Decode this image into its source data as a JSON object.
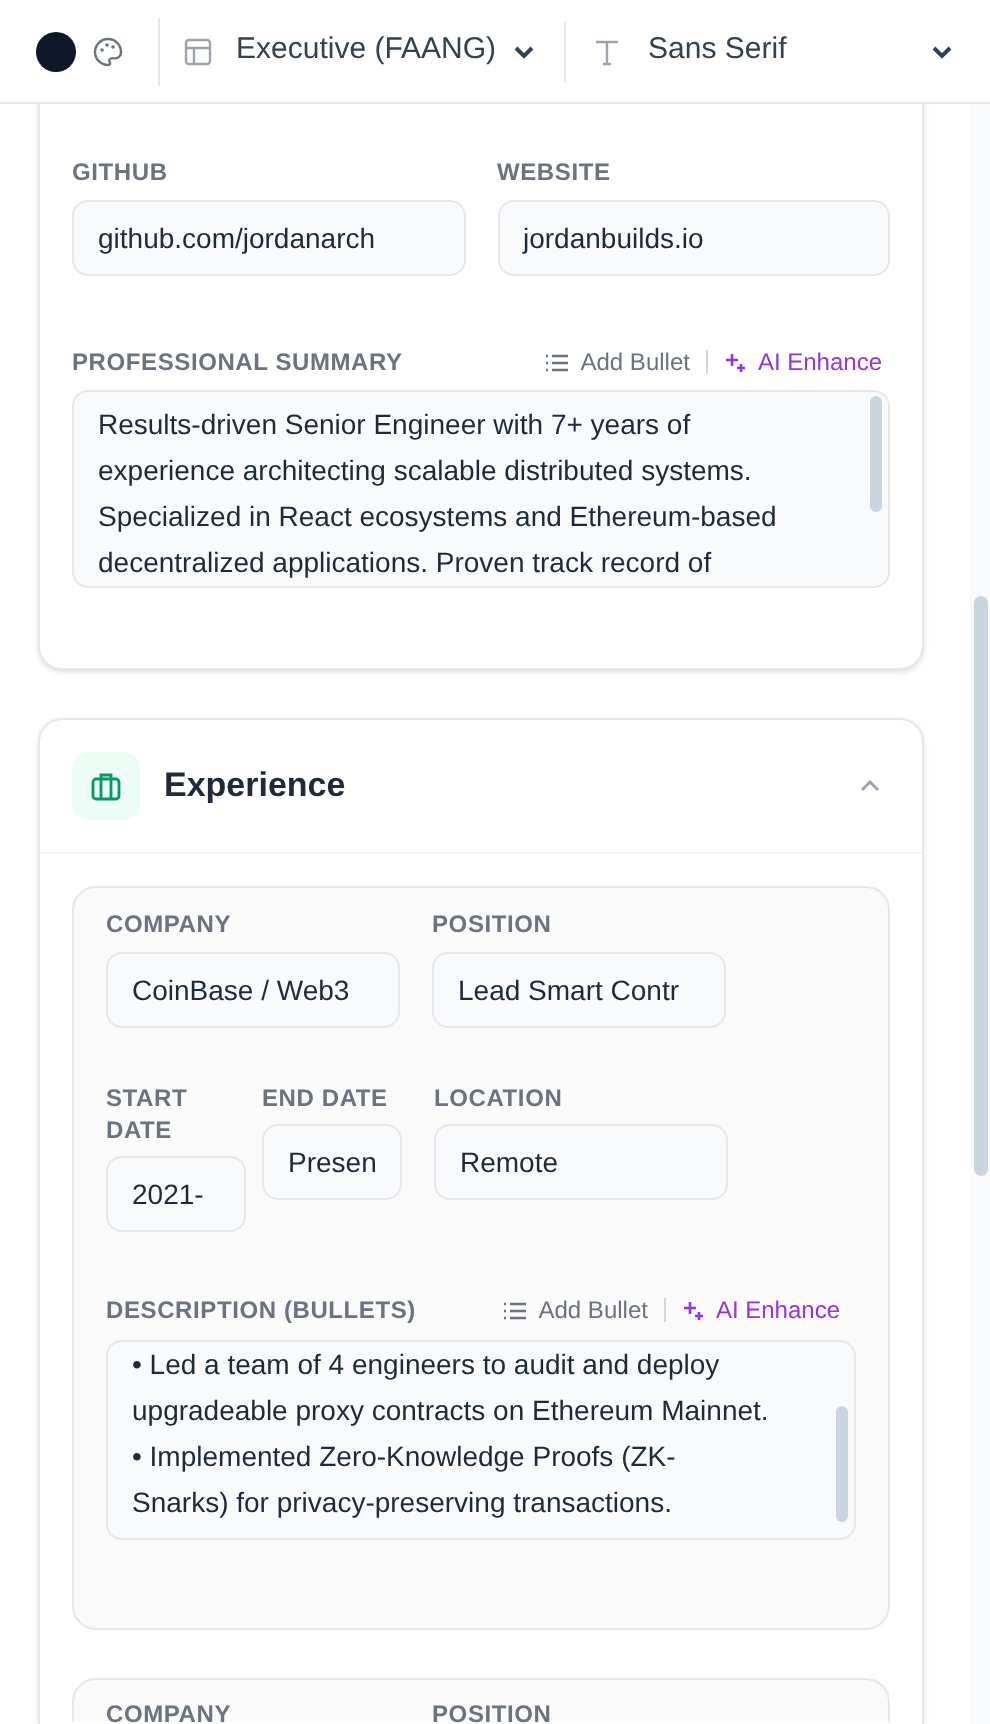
{
  "toolbar": {
    "template": "Executive (FAANG)",
    "font": "Sans Serif"
  },
  "links_section": {
    "fields": [
      {
        "label": "GITHUB",
        "value": "github.com/jordanarch"
      },
      {
        "label": "WEBSITE",
        "value": "jordanbuilds.io"
      }
    ],
    "summary": {
      "label": "PROFESSIONAL SUMMARY",
      "add_bullet": "Add Bullet",
      "ai_enhance": "AI Enhance",
      "lines": [
        "Results-driven Senior Engineer with 7+ years of",
        "experience architecting scalable distributed systems.",
        "Specialized in React ecosystems and Ethereum-based",
        "decentralized applications. Proven track record of"
      ]
    }
  },
  "experience": {
    "title": "Experience",
    "expanded": true,
    "entries": [
      {
        "company_label": "COMPANY",
        "company": "CoinBase / Web3",
        "position_label": "POSITION",
        "position": "Lead Smart Contr",
        "start_label": "START DATE",
        "start": "2021-",
        "end_label": "END DATE",
        "end": "Presen",
        "location_label": "LOCATION",
        "location": "Remote",
        "description_label": "DESCRIPTION (BULLETS)",
        "add_bullet": "Add Bullet",
        "ai_enhance": "AI Enhance",
        "lines": [
          "• Led a team of 4 engineers to audit and deploy",
          "upgradeable proxy contracts on Ethereum Mainnet.",
          "• Implemented Zero-Knowledge Proofs (ZK-",
          "Snarks) for privacy-preserving transactions."
        ]
      },
      {
        "company_label": "COMPANY",
        "position_label": "POSITION"
      }
    ]
  }
}
